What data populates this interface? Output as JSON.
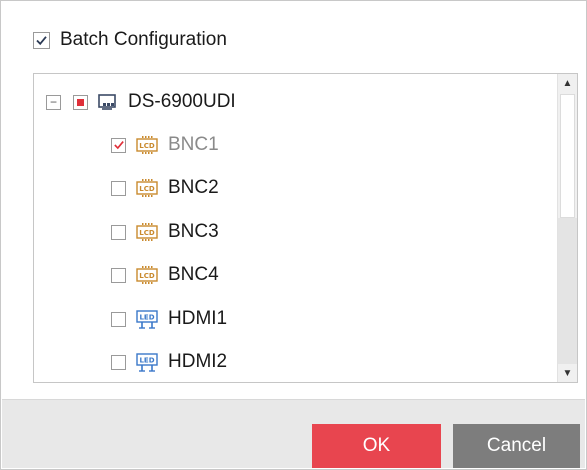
{
  "header": {
    "batch_label": "Batch Configuration",
    "batch_checked": true
  },
  "tree": {
    "root": {
      "label": "DS-6900UDI",
      "expander": "−",
      "state": "partial",
      "icon": "device-icon"
    },
    "items": [
      {
        "label": "BNC1",
        "checked": true,
        "icon": "lcd-icon"
      },
      {
        "label": "BNC2",
        "checked": false,
        "icon": "lcd-icon"
      },
      {
        "label": "BNC3",
        "checked": false,
        "icon": "lcd-icon"
      },
      {
        "label": "BNC4",
        "checked": false,
        "icon": "lcd-icon"
      },
      {
        "label": "HDMI1",
        "checked": false,
        "icon": "led-icon"
      },
      {
        "label": "HDMI2",
        "checked": false,
        "icon": "led-icon"
      }
    ]
  },
  "scrollbar": {
    "up_glyph": "▲",
    "down_glyph": "▼"
  },
  "footer": {
    "ok_label": "OK",
    "cancel_label": "Cancel"
  },
  "colors": {
    "ok_button": "#e8454f",
    "cancel_button": "#7d7d7d",
    "check_red": "#e0303a",
    "lcd_icon": "#c98a2e",
    "led_icon": "#3a78c9"
  }
}
